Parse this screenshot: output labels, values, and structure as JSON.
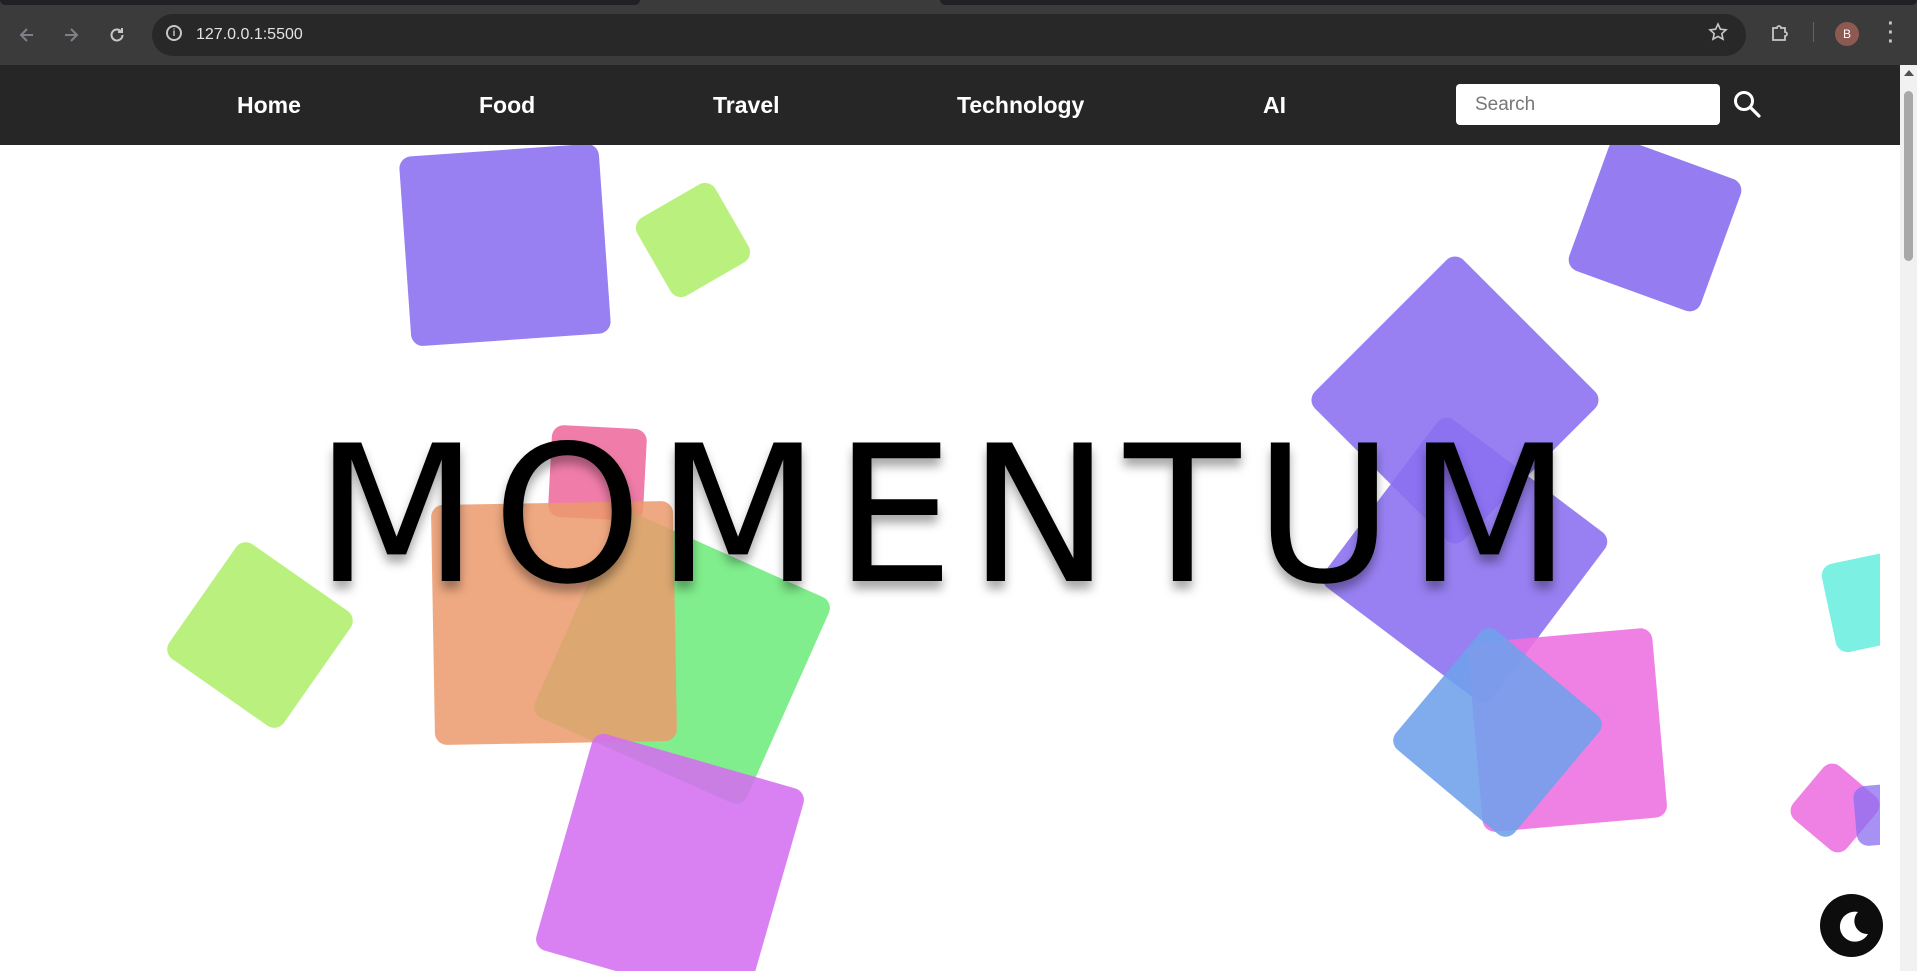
{
  "browser": {
    "url": "127.0.0.1:5500",
    "profile_initial": "B",
    "icons": {
      "back": "arrow-left-icon",
      "forward": "arrow-right-icon",
      "reload": "reload-icon",
      "site_info": "info-icon",
      "bookmark": "star-icon",
      "extensions": "puzzle-icon",
      "menu": "kebab-menu-icon"
    }
  },
  "nav": {
    "links": [
      "Home",
      "Food",
      "Travel",
      "Technology",
      "AI"
    ],
    "search_placeholder": "Search",
    "search_icon": "search-icon"
  },
  "hero": {
    "title": "MOMENTUM"
  },
  "theme_toggle": {
    "icon": "moon-icon"
  },
  "colors": {
    "nav_bg": "#262626",
    "purple": "#8a6ef0",
    "lime": "#b3ef70",
    "green": "#6eec7c",
    "orange": "#ec9a6c",
    "pink": "#ee6fa0",
    "magenta": "#d46ef0",
    "blue": "#6ea0ec",
    "hotpink": "#ee6fe0",
    "teal": "#6ef0e0"
  }
}
